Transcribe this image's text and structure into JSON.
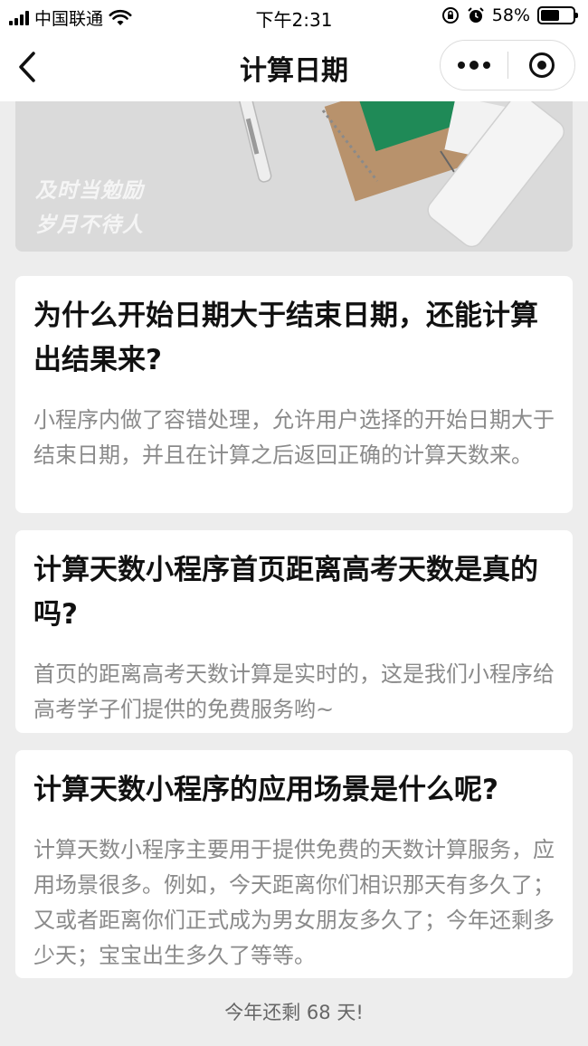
{
  "status_bar": {
    "carrier": "中国联通",
    "time": "下午2:31",
    "battery_percent": "58%",
    "battery_level": 0.58,
    "icons": [
      "signal-icon",
      "wifi-icon",
      "rotation-lock-icon",
      "alarm-icon",
      "battery-icon"
    ]
  },
  "nav": {
    "title": "计算日期",
    "icons": [
      "back-chevron-icon",
      "more-dots-icon",
      "close-target-icon"
    ]
  },
  "banner": {
    "line1": "及时当勉励",
    "line2": "岁月不待人"
  },
  "faq": [
    {
      "title": "为什么开始日期大于结束日期，还能计算出结果来?",
      "body": "小程序内做了容错处理，允许用户选择的开始日期大于结束日期，并且在计算之后返回正确的计算天数来。"
    },
    {
      "title": "计算天数小程序首页距离高考天数是真的吗?",
      "body": "首页的距离高考天数计算是实时的，这是我们小程序给高考学子们提供的免费服务哟~"
    },
    {
      "title": "计算天数小程序的应用场景是什么呢?",
      "body": "计算天数小程序主要用于提供免费的天数计算服务，应用场景很多。例如，今天距离你们相识那天有多久了；又或者距离你们正式成为男女朋友多久了；今年还剩多少天；宝宝出生多久了等等。"
    }
  ],
  "footer": {
    "text": "今年还剩 68 天!"
  },
  "colors": {
    "background": "#ededed",
    "card": "#ffffff",
    "title_text": "#111111",
    "body_text": "#8a8a8a"
  }
}
